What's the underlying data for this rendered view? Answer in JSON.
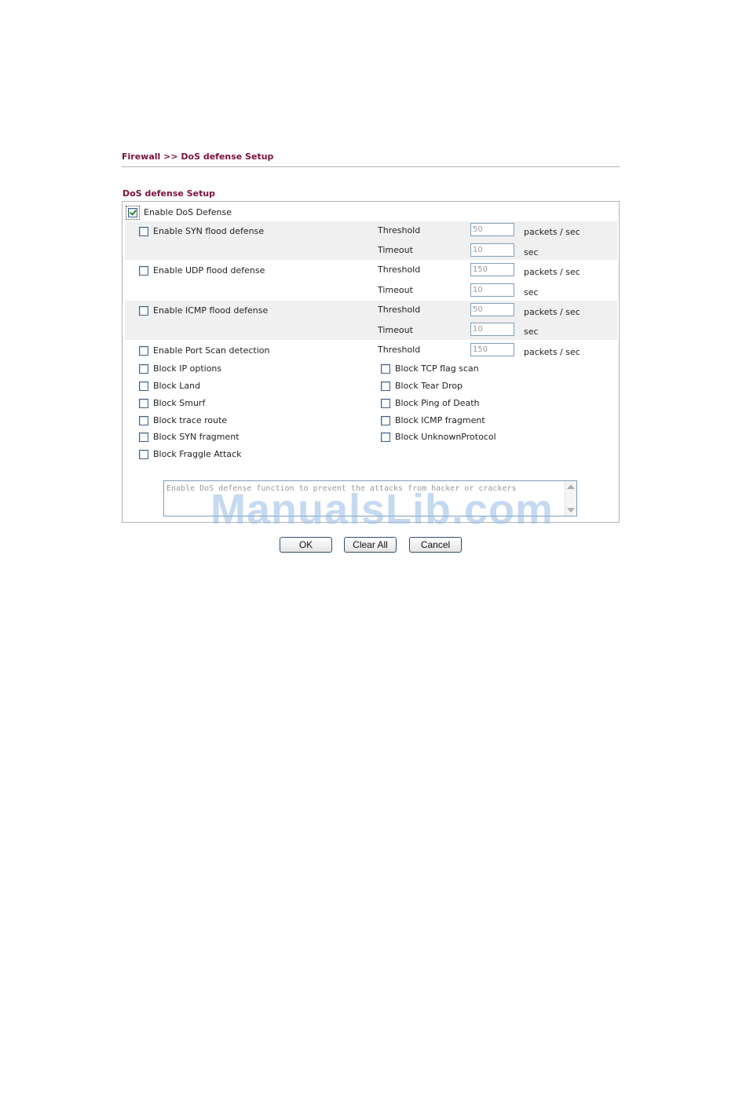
{
  "breadcrumb": "Firewall >> DoS defense Setup",
  "section_title": "DoS defense Setup",
  "enable_dos": {
    "label": "Enable DoS Defense",
    "checked": true
  },
  "flood_rows": [
    {
      "label": "Enable SYN flood defense",
      "threshold_label": "Threshold",
      "threshold_value": "50",
      "threshold_unit": "packets / sec",
      "timeout_label": "Timeout",
      "timeout_value": "10",
      "timeout_unit": "sec"
    },
    {
      "label": "Enable UDP flood defense",
      "threshold_label": "Threshold",
      "threshold_value": "150",
      "threshold_unit": "packets / sec",
      "timeout_label": "Timeout",
      "timeout_value": "10",
      "timeout_unit": "sec"
    },
    {
      "label": "Enable ICMP flood defense",
      "threshold_label": "Threshold",
      "threshold_value": "50",
      "threshold_unit": "packets / sec",
      "timeout_label": "Timeout",
      "timeout_value": "10",
      "timeout_unit": "sec"
    }
  ],
  "port_scan": {
    "label": "Enable Port Scan detection",
    "threshold_label": "Threshold",
    "threshold_value": "150",
    "threshold_unit": "packets / sec"
  },
  "block_left": [
    "Block IP options",
    "Block Land",
    "Block Smurf",
    "Block trace route",
    "Block SYN fragment",
    "Block Fraggle Attack"
  ],
  "block_right": [
    "Block TCP flag scan",
    "Block Tear Drop",
    "Block Ping of Death",
    "Block ICMP fragment",
    "Block UnknownProtocol"
  ],
  "description": "Enable DoS defense function to prevent the attacks from hacker or crackers",
  "buttons": {
    "ok": "OK",
    "clear_all": "Clear All",
    "cancel": "Cancel"
  },
  "watermark": "ManualsLib.com",
  "colors": {
    "heading": "#7a1040",
    "band": "#f0f0f0",
    "border": "#b5b5b5",
    "check": "#1b8a1b"
  }
}
